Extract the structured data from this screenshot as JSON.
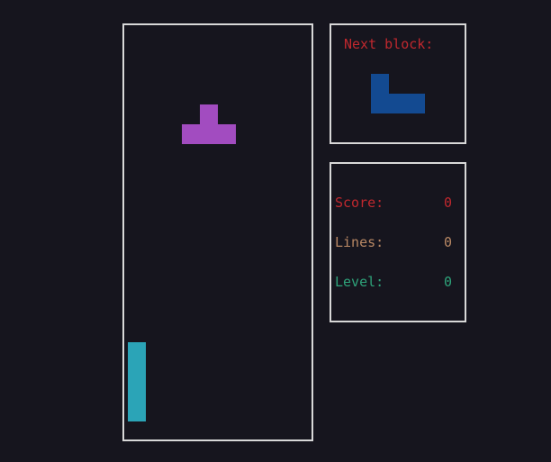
{
  "colors": {
    "background": "#16151e",
    "border": "#d8d8d8",
    "t_piece": "#a24cc0",
    "i_piece": "#2ba4b7",
    "l_piece": "#134a91",
    "score_color": "#c0282e",
    "lines_color": "#b98864",
    "level_color": "#2ea37a",
    "next_title_color": "#c0282e"
  },
  "board": {
    "columns": 10,
    "rows": 21,
    "falling_piece": {
      "type": "T",
      "color_key": "t_piece",
      "cells": [
        [
          4,
          4
        ],
        [
          3,
          5
        ],
        [
          4,
          5
        ],
        [
          5,
          5
        ]
      ]
    },
    "stacked_cells": [
      {
        "col": 0,
        "row": 16,
        "color_key": "i_piece"
      },
      {
        "col": 0,
        "row": 17,
        "color_key": "i_piece"
      },
      {
        "col": 0,
        "row": 18,
        "color_key": "i_piece"
      },
      {
        "col": 0,
        "row": 19,
        "color_key": "i_piece"
      }
    ]
  },
  "next": {
    "title": "Next block:",
    "piece": {
      "type": "L",
      "color_key": "l_piece",
      "cells": [
        [
          0,
          0
        ],
        [
          0,
          1
        ],
        [
          1,
          1
        ],
        [
          2,
          1
        ]
      ]
    }
  },
  "stats": {
    "score_label": "Score:",
    "score_value": "0",
    "lines_label": "Lines:",
    "lines_value": "0",
    "level_label": "Level:",
    "level_value": "0"
  }
}
